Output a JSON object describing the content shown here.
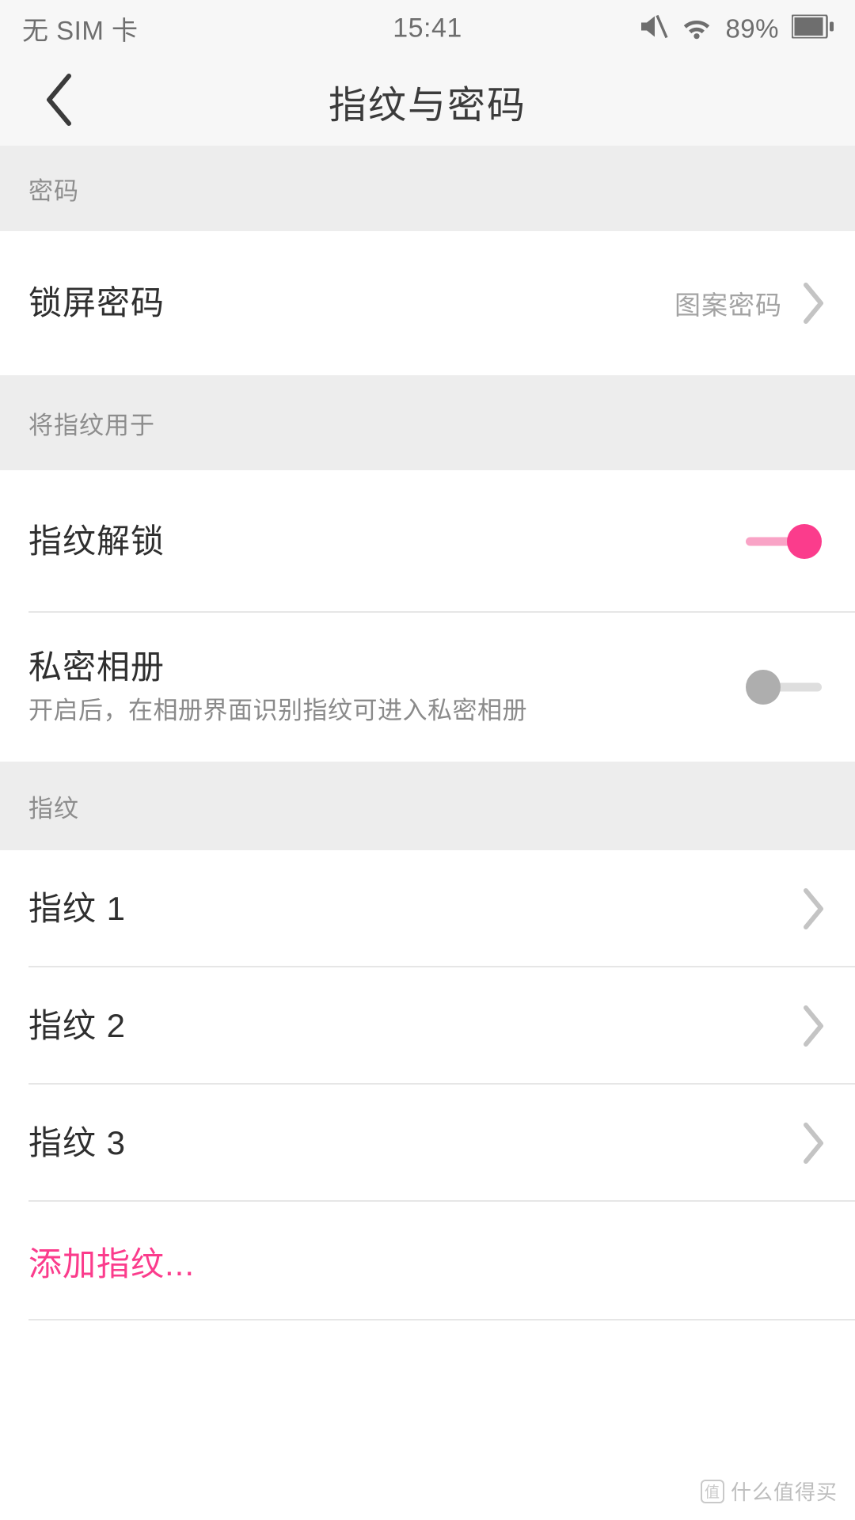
{
  "status_bar": {
    "carrier": "无 SIM 卡",
    "time": "15:41",
    "battery_percent": "89%",
    "icons": [
      "mute-icon",
      "wifi-icon",
      "battery-icon"
    ]
  },
  "header": {
    "title": "指纹与密码",
    "back_icon": "chevron-left-icon"
  },
  "sections": [
    {
      "header": "密码",
      "rows": [
        {
          "label": "锁屏密码",
          "value": "图案密码",
          "type": "navigation"
        }
      ]
    },
    {
      "header": "将指纹用于",
      "rows": [
        {
          "label": "指纹解锁",
          "type": "switch",
          "state": "on"
        },
        {
          "label": "私密相册",
          "sub": "开启后，在相册界面识别指纹可进入私密相册",
          "type": "switch",
          "state": "off"
        }
      ]
    },
    {
      "header": "指纹",
      "rows": [
        {
          "label": "指纹 1",
          "type": "navigation"
        },
        {
          "label": "指纹 2",
          "type": "navigation"
        },
        {
          "label": "指纹 3",
          "type": "navigation"
        },
        {
          "label": "添加指纹...",
          "type": "action"
        }
      ]
    }
  ],
  "watermark": {
    "badge": "值",
    "text": "什么值得买"
  },
  "colors": {
    "accent_pink": "#fb3c8c",
    "track_pink": "#f9a3c6",
    "section_bg": "#ededed",
    "bar_bg": "#f7f7f7",
    "text_primary": "#2f2f2f",
    "text_secondary": "#8a8a8a"
  }
}
